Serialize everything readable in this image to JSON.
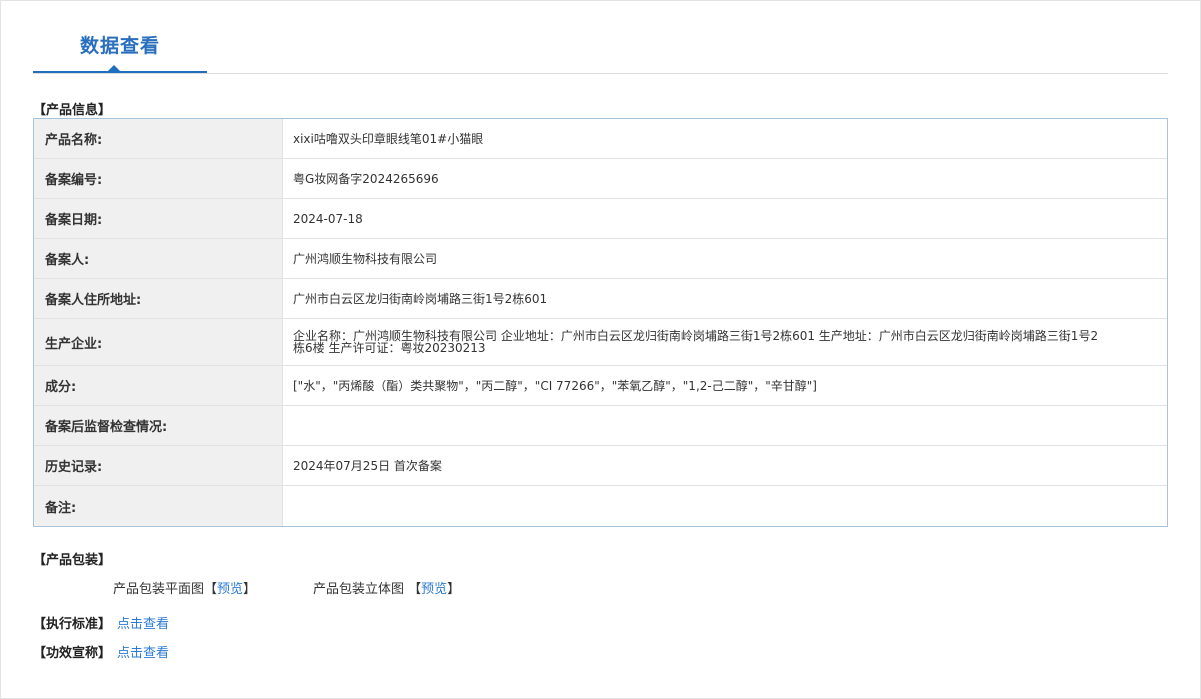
{
  "header": {
    "tab_title": "数据查看"
  },
  "product_info": {
    "section_title": "【产品信息】",
    "rows": [
      {
        "label": "产品名称:",
        "value": "xixi咕噜双头印章眼线笔01#小猫眼"
      },
      {
        "label": "备案编号:",
        "value": "粤G妆网备字2024265696"
      },
      {
        "label": "备案日期:",
        "value": "2024-07-18"
      },
      {
        "label": "备案人:",
        "value": "广州鸿顺生物科技有限公司"
      },
      {
        "label": "备案人住所地址:",
        "value": "广州市白云区龙归街南岭岗埔路三街1号2栋601"
      },
      {
        "label": "生产企业:",
        "value": "企业名称：广州鸿顺生物科技有限公司 企业地址：广州市白云区龙归街南岭岗埔路三街1号2栋601 生产地址：广州市白云区龙归街南岭岗埔路三街1号2栋6楼 生产许可证：粤妆20230213"
      },
      {
        "label": "成分:",
        "value": "[\"水\"，\"丙烯酸（酯）类共聚物\"，\"丙二醇\"，\"CI 77266\"，\"苯氧乙醇\"，\"1,2-己二醇\"，\"辛甘醇\"]"
      },
      {
        "label": "备案后监督检查情况:",
        "value": ""
      },
      {
        "label": "历史记录:",
        "value": "2024年07月25日 首次备案"
      },
      {
        "label": "备注:",
        "value": ""
      }
    ]
  },
  "packaging": {
    "section_title": "【产品包装】",
    "flat_label": "产品包装平面图",
    "flat_bracket_open": "【",
    "flat_link": "预览",
    "flat_bracket_close": "】",
    "stereo_label": "产品包装立体图 ",
    "stereo_bracket_open": "【",
    "stereo_link": "预览",
    "stereo_bracket_close": "】"
  },
  "standard": {
    "label": "【执行标准】",
    "link": "点击查看"
  },
  "efficacy": {
    "label": "【功效宣称】",
    "link": "点击查看"
  }
}
